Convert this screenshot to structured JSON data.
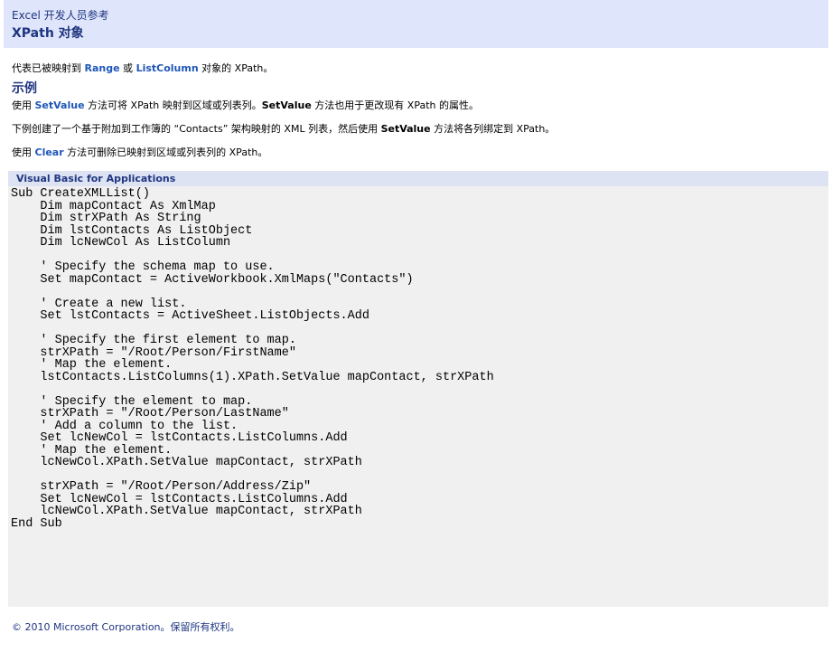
{
  "header": {
    "product": "Excel 开发人员参考",
    "title": "XPath 对象"
  },
  "intro": {
    "prefix": "代表已被映射到 ",
    "range": "Range",
    "or": " 或 ",
    "listcolumn": "ListColumn",
    "suffix": " 对象的 XPath。"
  },
  "section_title": "示例",
  "para1": {
    "prefix": "使用 ",
    "setvalue": "SetValue",
    "middle": " 方法可将 XPath 映射到区域或列表列。",
    "setvalue2": "SetValue",
    "suffix": " 方法也用于更改现有 XPath 的属性。"
  },
  "para2": {
    "prefix": "下例创建了一个基于附加到工作簿的 “Contacts” 架构映射的 XML 列表，然后使用 ",
    "setvalue": "SetValue",
    "suffix": " 方法将各列绑定到 XPath。"
  },
  "para3": {
    "prefix": "使用 ",
    "clear": "Clear",
    "suffix": " 方法可删除已映射到区域或列表列的 XPath。"
  },
  "code": {
    "language": "Visual Basic for Applications",
    "text": "Sub CreateXMLList()\n    Dim mapContact As XmlMap\n    Dim strXPath As String\n    Dim lstContacts As ListObject\n    Dim lcNewCol As ListColumn\n\n    ' Specify the schema map to use.\n    Set mapContact = ActiveWorkbook.XmlMaps(\"Contacts\")\n\n    ' Create a new list.\n    Set lstContacts = ActiveSheet.ListObjects.Add\n\n    ' Specify the first element to map.\n    strXPath = \"/Root/Person/FirstName\"\n    ' Map the element.\n    lstContacts.ListColumns(1).XPath.SetValue mapContact, strXPath\n\n    ' Specify the element to map.\n    strXPath = \"/Root/Person/LastName\"\n    ' Add a column to the list.\n    Set lcNewCol = lstContacts.ListColumns.Add\n    ' Map the element.\n    lcNewCol.XPath.SetValue mapContact, strXPath\n\n    strXPath = \"/Root/Person/Address/Zip\"\n    Set lcNewCol = lstContacts.ListColumns.Add\n    lcNewCol.XPath.SetValue mapContact, strXPath\nEnd Sub"
  },
  "footer": "© 2010 Microsoft Corporation。保留所有权利。"
}
